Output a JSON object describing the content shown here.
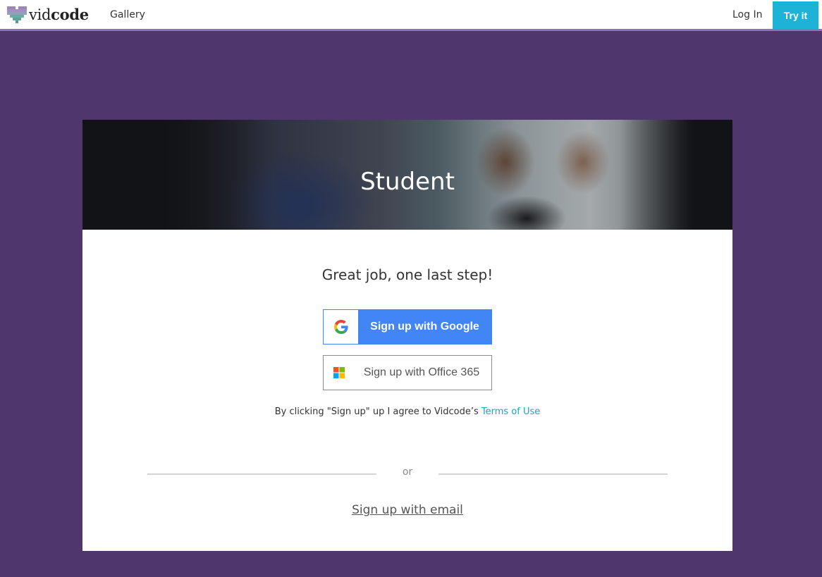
{
  "header": {
    "logo_prefix": "vid",
    "logo_suffix": "code",
    "nav_gallery": "Gallery",
    "nav_login": "Log In",
    "nav_try": "Try it"
  },
  "hero": {
    "title": "Student"
  },
  "signup": {
    "subtitle": "Great job, one last step!",
    "google_label": "Sign up with Google",
    "office_label": "Sign up with Office 365",
    "terms_prefix": "By clicking \"Sign up\" up I agree to Vidcode’s ",
    "terms_link": "Terms of Use",
    "divider_text": "or",
    "email_link": "Sign up with email"
  },
  "colors": {
    "page_background": "#4f366d",
    "nav_accent_border": "#8b74b8",
    "try_button": "#1cb3d6",
    "google_blue": "#4285f4",
    "link_teal": "#1aa5c6"
  },
  "icons": {
    "logo": "pixel-heart-icon",
    "google": "google-g-icon",
    "microsoft": "microsoft-squares-icon"
  }
}
